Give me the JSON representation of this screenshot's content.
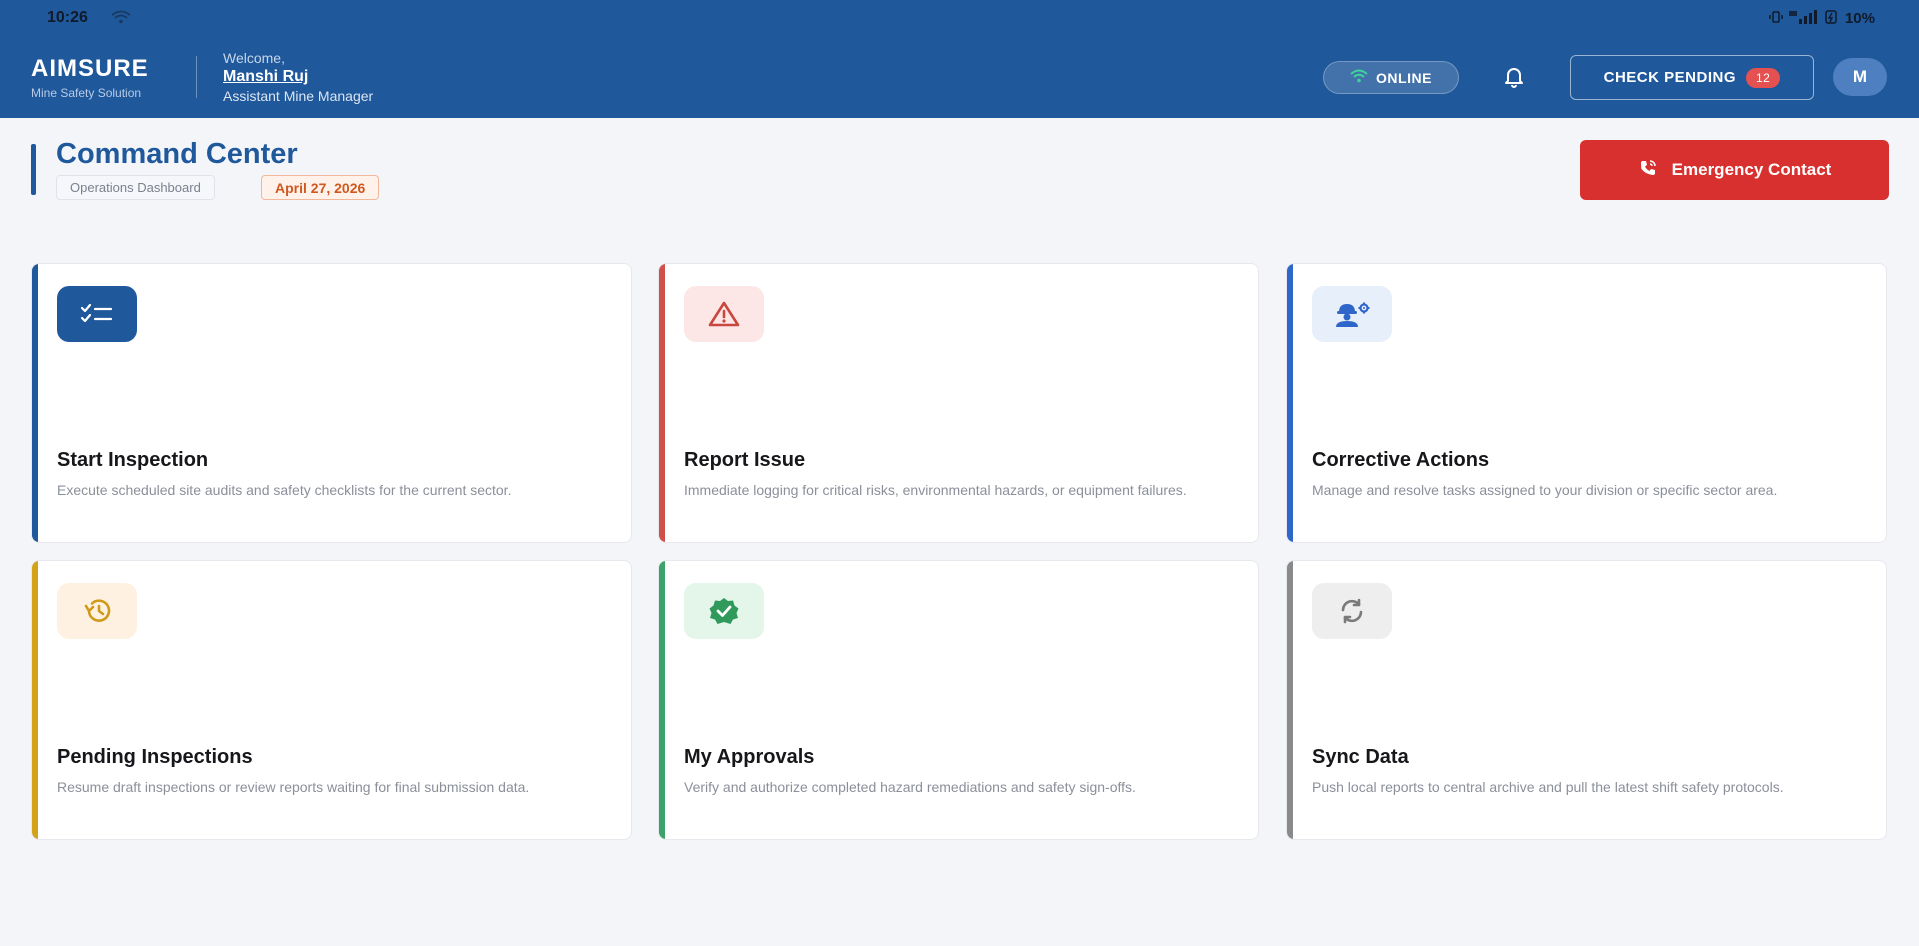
{
  "status_bar": {
    "time": "10:26",
    "battery": "10%"
  },
  "header": {
    "brand_name": "AIMSURE",
    "brand_tagline": "Mine Safety Solution",
    "welcome": "Welcome,",
    "user_name": "Manshi Ruj",
    "user_role": "Assistant Mine Manager",
    "online_label": "ONLINE",
    "check_pending_label": "CHECK PENDING",
    "pending_count": "12",
    "avatar_initial": "M",
    "colors": {
      "bar": "#1f589b",
      "badge": "#e55151"
    }
  },
  "page": {
    "title": "Command Center",
    "subtitle_chip": "Operations Dashboard",
    "date_chip": "April 27, 2026",
    "emergency_label": "Emergency Contact",
    "emergency_color": "#d8302e"
  },
  "cards": [
    {
      "title": "Start Inspection",
      "description": "Execute scheduled site audits and safety checklists for the current sector.",
      "icon": "checklist-icon",
      "accent": "#1f589b"
    },
    {
      "title": "Report Issue",
      "description": "Immediate logging for critical risks, environmental hazards, or equipment failures.",
      "icon": "warning-icon",
      "accent": "#d0504b"
    },
    {
      "title": "Corrective Actions",
      "description": "Manage and resolve tasks assigned to your division or specific sector area.",
      "icon": "worker-gear-icon",
      "accent": "#2f66c9"
    },
    {
      "title": "Pending Inspections",
      "description": "Resume draft inspections or review reports waiting for final submission data.",
      "icon": "history-icon",
      "accent": "#d4a418"
    },
    {
      "title": "My Approvals",
      "description": "Verify and authorize completed hazard remediations and safety sign-offs.",
      "icon": "verified-badge-icon",
      "accent": "#3aa368"
    },
    {
      "title": "Sync Data",
      "description": "Push local reports to central archive and pull the latest shift safety protocols.",
      "icon": "sync-icon",
      "accent": "#8a8a8a"
    }
  ]
}
